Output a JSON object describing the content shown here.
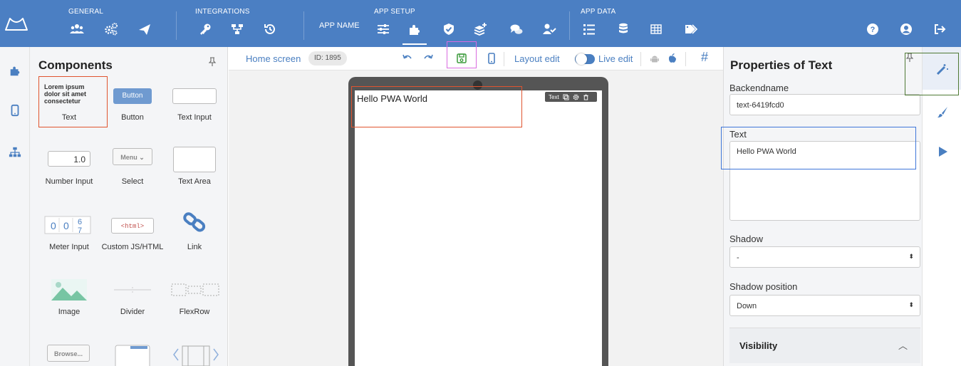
{
  "nav": {
    "groups": {
      "general": "GENERAL",
      "integrations": "INTEGRATIONS",
      "app_setup": "APP SETUP",
      "app_data": "APP DATA"
    },
    "app_name": "APP NAME",
    "icons": {
      "logo": "mountain-logo",
      "general": [
        "users-icon",
        "gears-icon",
        "paper-plane-icon"
      ],
      "integrations": [
        "key-icon",
        "network-icon",
        "history-icon"
      ],
      "app_setup": [
        "sliders-icon",
        "puzzle-icon",
        "shield-icon",
        "layers-plus-icon",
        "chat-icon",
        "user-check-icon"
      ],
      "app_data": [
        "list-icon",
        "database-icon",
        "table-icon",
        "tags-icon"
      ],
      "right": [
        "help-icon",
        "user-circle-icon",
        "logout-icon"
      ]
    }
  },
  "left_rail": {
    "icons": [
      "puzzle-icon",
      "mobile-icon",
      "sitemap-icon"
    ]
  },
  "components": {
    "title": "Components",
    "items": [
      {
        "label": "Text",
        "preview": "Lorem ipsum dolor sit amet consectetur"
      },
      {
        "label": "Button",
        "preview": "Button"
      },
      {
        "label": "Text Input",
        "preview": ""
      },
      {
        "label": "Number Input",
        "preview": "1.0"
      },
      {
        "label": "Select",
        "preview": "Menu"
      },
      {
        "label": "Text Area",
        "preview": ""
      },
      {
        "label": "Meter Input",
        "preview": "0 0 6 7"
      },
      {
        "label": "Custom JS/HTML",
        "preview": "<html>"
      },
      {
        "label": "Link",
        "preview": ""
      },
      {
        "label": "Image",
        "preview": ""
      },
      {
        "label": "Divider",
        "preview": ""
      },
      {
        "label": "FlexRow",
        "preview": ""
      },
      {
        "label": "",
        "preview": "Browse..."
      },
      {
        "label": "",
        "preview": ""
      },
      {
        "label": "",
        "preview": ""
      }
    ]
  },
  "toolbar": {
    "screen_name": "Home screen",
    "screen_id": "ID: 1895",
    "layout_edit": "Layout edit",
    "live_edit": "Live edit",
    "hash": "#"
  },
  "canvas": {
    "text_content": "Hello PWA World",
    "element_toolbar_label": "Text"
  },
  "properties": {
    "title": "Properties of Text",
    "backendname_label": "Backendname",
    "backendname_value": "text-6419fcd0",
    "text_label": "Text",
    "text_value": "Hello PWA World",
    "shadow_label": "Shadow",
    "shadow_value": "-",
    "shadow_position_label": "Shadow position",
    "shadow_position_value": "Down",
    "visibility_label": "Visibility"
  },
  "right_rail": {
    "icons": [
      "magic-wand-icon",
      "brush-icon",
      "play-icon"
    ]
  },
  "colors": {
    "nav_bg": "#4b7fc3",
    "link": "#4a7fc1",
    "panel_bg": "#f4f5f7",
    "highlight_red": "#e0542f",
    "highlight_blue": "#3f76d9",
    "highlight_green": "#4f7a35",
    "highlight_pink": "#d96be0"
  }
}
